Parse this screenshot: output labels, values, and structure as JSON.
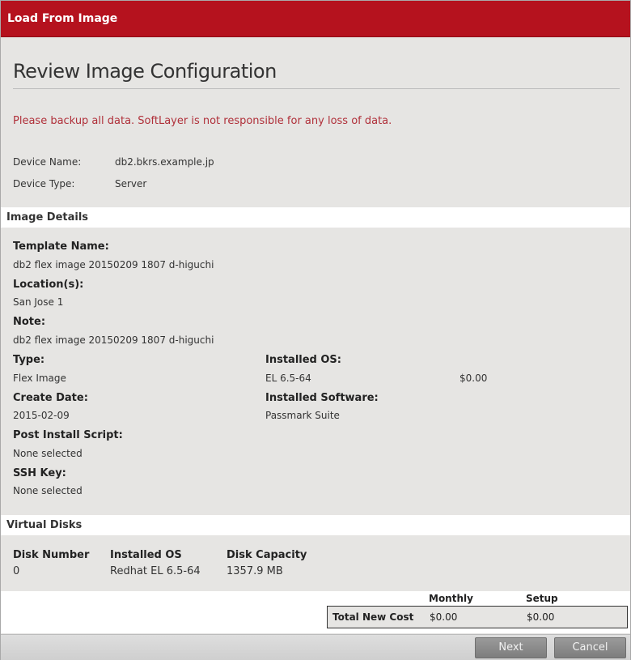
{
  "dialog": {
    "title": "Load From Image",
    "heading": "Review Image Configuration",
    "warning": "Please backup all data. SoftLayer is not responsible for any loss of data."
  },
  "device": {
    "name_label": "Device Name:",
    "name_value": "db2.bkrs.example.jp",
    "type_label": "Device Type:",
    "type_value": "Server"
  },
  "image_details": {
    "section_title": "Image Details",
    "template_name_label": "Template Name:",
    "template_name_value": "db2 flex image 20150209 1807 d-higuchi",
    "locations_label": "Location(s):",
    "locations_value": "San Jose 1",
    "note_label": "Note:",
    "note_value": "db2 flex image 20150209 1807 d-higuchi",
    "type_label": "Type:",
    "type_value": "Flex Image",
    "create_date_label": "Create Date:",
    "create_date_value": "2015-02-09",
    "post_install_label": "Post Install Script:",
    "post_install_value": "None selected",
    "ssh_key_label": "SSH Key:",
    "ssh_key_value": "None selected",
    "installed_os_label": "Installed OS:",
    "installed_os_value": "EL 6.5-64",
    "installed_os_price": "$0.00",
    "installed_software_label": "Installed Software:",
    "installed_software_value": "Passmark Suite"
  },
  "virtual_disks": {
    "section_title": "Virtual Disks",
    "columns": [
      "Disk Number",
      "Installed OS",
      "Disk Capacity"
    ],
    "rows": [
      [
        "0",
        "Redhat EL 6.5-64",
        "1357.9 MB"
      ]
    ]
  },
  "cost": {
    "monthly_header": "Monthly",
    "setup_header": "Setup",
    "total_label": "Total New Cost",
    "monthly_value": "$0.00",
    "setup_value": "$0.00"
  },
  "buttons": {
    "next": "Next",
    "cancel": "Cancel"
  }
}
